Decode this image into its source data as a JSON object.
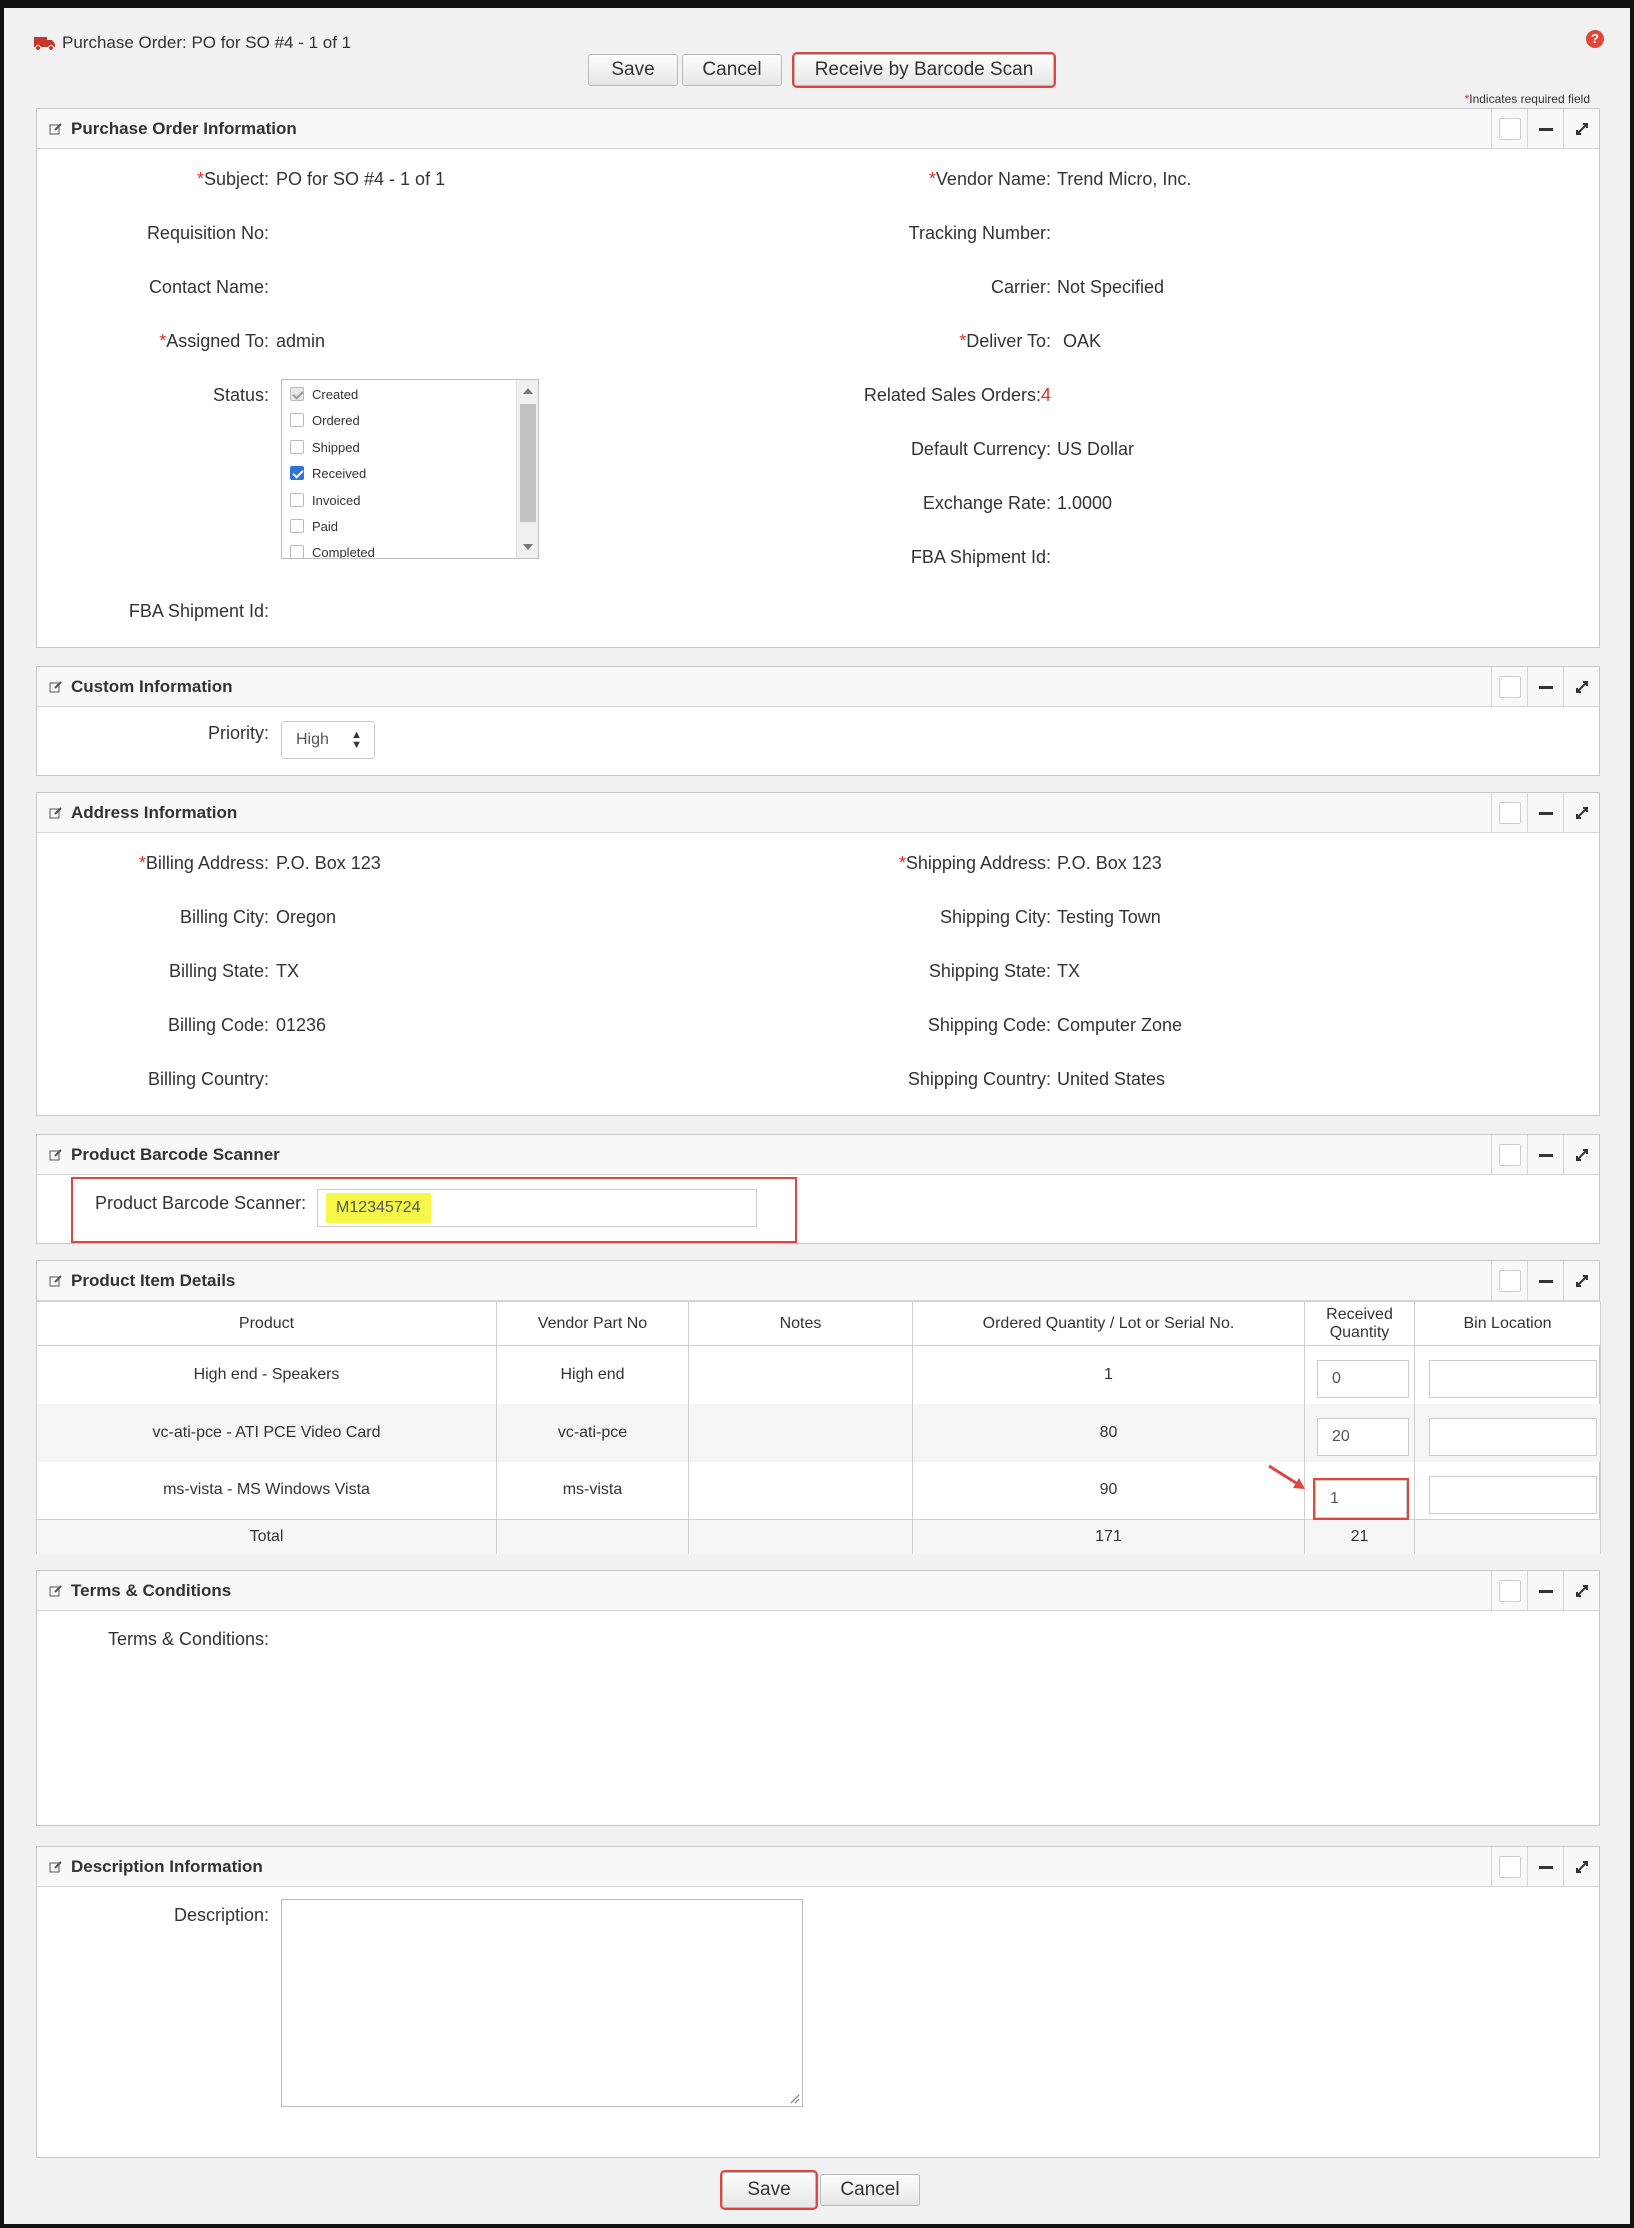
{
  "header": {
    "title": "Purchase Order: PO for SO #4 - 1 of 1",
    "help": "?"
  },
  "toolbar": {
    "save": "Save",
    "cancel": "Cancel",
    "receive": "Receive by Barcode Scan"
  },
  "required_note": {
    "star": "*",
    "text": "Indicates required field"
  },
  "po_info": {
    "title": "Purchase Order Information",
    "subject_label": "Subject:",
    "subject": "PO for SO #4 - 1 of 1",
    "vendor_label": "Vendor Name:",
    "vendor": "Trend Micro, Inc.",
    "requisition_label": "Requisition No:",
    "tracking_label": "Tracking Number:",
    "contact_label": "Contact Name:",
    "carrier_label": "Carrier:",
    "carrier": "Not Specified",
    "assigned_label": "Assigned To:",
    "assigned": "admin",
    "deliver_label": "Deliver To:",
    "deliver": "OAK",
    "status_label": "Status:",
    "status_options": [
      "Created",
      "Ordered",
      "Shipped",
      "Received",
      "Invoiced",
      "Paid",
      "Completed"
    ],
    "related_label": "Related Sales Orders:",
    "related": "4",
    "currency_label": "Default Currency:",
    "currency": "US Dollar",
    "rate_label": "Exchange Rate:",
    "rate": "1.0000",
    "fba_label": "FBA Shipment Id:"
  },
  "custom_info": {
    "title": "Custom Information",
    "priority_label": "Priority:",
    "priority": "High"
  },
  "address": {
    "title": "Address Information",
    "billing_address_label": "Billing Address:",
    "billing_address": "P.O. Box 123",
    "shipping_address_label": "Shipping Address:",
    "shipping_address": "P.O. Box 123",
    "billing_city_label": "Billing City:",
    "billing_city": "Oregon",
    "shipping_city_label": "Shipping City:",
    "shipping_city": "Testing Town",
    "billing_state_label": "Billing State:",
    "billing_state": "TX",
    "shipping_state_label": "Shipping State:",
    "shipping_state": "TX",
    "billing_code_label": "Billing Code:",
    "billing_code": "01236",
    "shipping_code_label": "Shipping Code:",
    "shipping_code": "Computer Zone",
    "billing_country_label": "Billing Country:",
    "shipping_country_label": "Shipping Country:",
    "shipping_country": "United States"
  },
  "barcode": {
    "title": "Product Barcode Scanner",
    "label": "Product Barcode Scanner:",
    "value": "M12345724"
  },
  "items": {
    "title": "Product Item Details",
    "columns": [
      "Product",
      "Vendor Part No",
      "Notes",
      "Ordered Quantity / Lot or Serial No.",
      "Received Quantity",
      "Bin Location"
    ],
    "rows": [
      {
        "product": "High end - Speakers",
        "part": "High end",
        "notes": "",
        "ordered": "1",
        "received": "0"
      },
      {
        "product": "vc-ati-pce - ATI PCE Video Card",
        "part": "vc-ati-pce",
        "notes": "",
        "ordered": "80",
        "received": "20"
      },
      {
        "product": "ms-vista - MS Windows Vista",
        "part": "ms-vista",
        "notes": "",
        "ordered": "90",
        "received": "1"
      }
    ],
    "total_label": "Total",
    "total_ordered": "171",
    "total_received": "21"
  },
  "terms": {
    "title": "Terms & Conditions",
    "label": "Terms & Conditions:"
  },
  "description": {
    "title": "Description Information",
    "label": "Description:"
  },
  "footer": {
    "save": "Save",
    "cancel": "Cancel"
  },
  "colors": {
    "highlight": "#e0443e",
    "required": "#d9322a",
    "barcode_highlight": "#f7f74a",
    "checked": "#2f73d8"
  }
}
